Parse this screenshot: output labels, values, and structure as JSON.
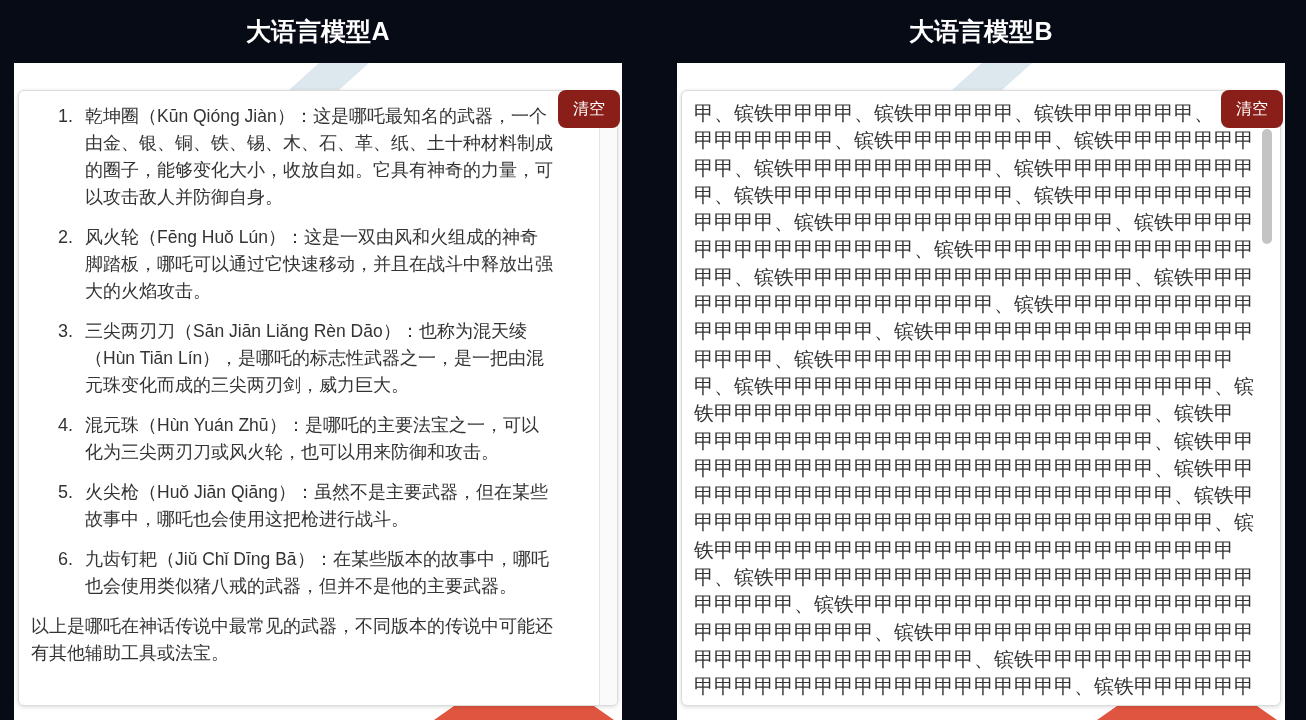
{
  "panels": [
    {
      "title": "大语言模型A",
      "kind": "list",
      "clear_button": "清空",
      "items": [
        {
          "number": "1.",
          "text": "乾坤圈（Kūn Qióng Jiàn）：这是哪吒最知名的武器，一个由金、银、铜、铁、锡、木、石、革、纸、土十种材料制成的圈子，能够变化大小，收放自如。它具有神奇的力量，可以攻击敌人并防御自身。"
        },
        {
          "number": "2.",
          "text": "风火轮（Fēng Huǒ Lún）：这是一双由风和火组成的神奇脚踏板，哪吒可以通过它快速移动，并且在战斗中释放出强大的火焰攻击。"
        },
        {
          "number": "3.",
          "text": "三尖两刃刀（Sān Jiān Liǎng Rèn Dāo）：也称为混天绫（Hùn Tiān Lín），是哪吒的标志性武器之一，是一把由混元珠变化而成的三尖两刃剑，威力巨大。"
        },
        {
          "number": "4.",
          "text": "混元珠（Hùn Yuán Zhū）：是哪吒的主要法宝之一，可以化为三尖两刃刀或风火轮，也可以用来防御和攻击。"
        },
        {
          "number": "5.",
          "text": "火尖枪（Huǒ Jiān Qiāng）：虽然不是主要武器，但在某些故事中，哪吒也会使用这把枪进行战斗。"
        },
        {
          "number": "6.",
          "text": "九齿钉耙（Jiǔ Chǐ Dīng Bā）：在某些版本的故事中，哪吒也会使用类似猪八戒的武器，但并不是他的主要武器。"
        }
      ],
      "summary": "以上是哪吒在神话传说中最常见的武器，不同版本的传说中可能还有其他辅助工具或法宝。"
    },
    {
      "title": "大语言模型B",
      "kind": "lines",
      "clear_button": "清空",
      "lines": [
        "甲、镔铁甲甲甲甲、镔铁甲甲甲甲甲、镔铁甲甲甲甲甲甲、",
        "甲甲甲甲甲甲甲、镔铁甲甲甲甲甲甲甲甲、镔铁甲甲甲甲甲甲甲",
        "甲甲、镔铁甲甲甲甲甲甲甲甲甲甲、镔铁甲甲甲甲甲甲甲甲甲甲",
        "甲、镔铁甲甲甲甲甲甲甲甲甲甲甲甲、镔铁甲甲甲甲甲甲甲甲甲",
        "甲甲甲甲、镔铁甲甲甲甲甲甲甲甲甲甲甲甲甲甲、镔铁甲甲甲甲",
        "甲甲甲甲甲甲甲甲甲甲甲、镔铁甲甲甲甲甲甲甲甲甲甲甲甲甲甲",
        "甲甲、镔铁甲甲甲甲甲甲甲甲甲甲甲甲甲甲甲甲甲、镔铁甲甲甲",
        "甲甲甲甲甲甲甲甲甲甲甲甲甲甲甲、镔铁甲甲甲甲甲甲甲甲甲甲",
        "甲甲甲甲甲甲甲甲甲、镔铁甲甲甲甲甲甲甲甲甲甲甲甲甲甲甲甲",
        "甲甲甲甲、镔铁甲甲甲甲甲甲甲甲甲甲甲甲甲甲甲甲甲甲甲甲",
        "甲、镔铁甲甲甲甲甲甲甲甲甲甲甲甲甲甲甲甲甲甲甲甲甲甲、镔",
        "铁甲甲甲甲甲甲甲甲甲甲甲甲甲甲甲甲甲甲甲甲甲甲、镔铁甲",
        "甲甲甲甲甲甲甲甲甲甲甲甲甲甲甲甲甲甲甲甲甲甲甲、镔铁甲甲",
        "甲甲甲甲甲甲甲甲甲甲甲甲甲甲甲甲甲甲甲甲甲甲甲、镔铁甲甲",
        "甲甲甲甲甲甲甲甲甲甲甲甲甲甲甲甲甲甲甲甲甲甲甲甲、镔铁甲",
        "甲甲甲甲甲甲甲甲甲甲甲甲甲甲甲甲甲甲甲甲甲甲甲甲甲甲、镔",
        "铁甲甲甲甲甲甲甲甲甲甲甲甲甲甲甲甲甲甲甲甲甲甲甲甲甲甲",
        "甲、镔铁甲甲甲甲甲甲甲甲甲甲甲甲甲甲甲甲甲甲甲甲甲甲甲甲",
        "甲甲甲甲甲、镔铁甲甲甲甲甲甲甲甲甲甲甲甲甲甲甲甲甲甲甲甲",
        "甲甲甲甲甲甲甲甲甲、镔铁甲甲甲甲甲甲甲甲甲甲甲甲甲甲甲甲",
        "甲甲甲甲甲甲甲甲甲甲甲甲甲甲、镔铁甲甲甲甲甲甲甲甲甲甲甲",
        "甲甲甲甲甲甲甲甲甲甲甲甲甲甲甲甲甲甲甲、镔铁甲甲甲甲甲甲"
      ]
    }
  ]
}
